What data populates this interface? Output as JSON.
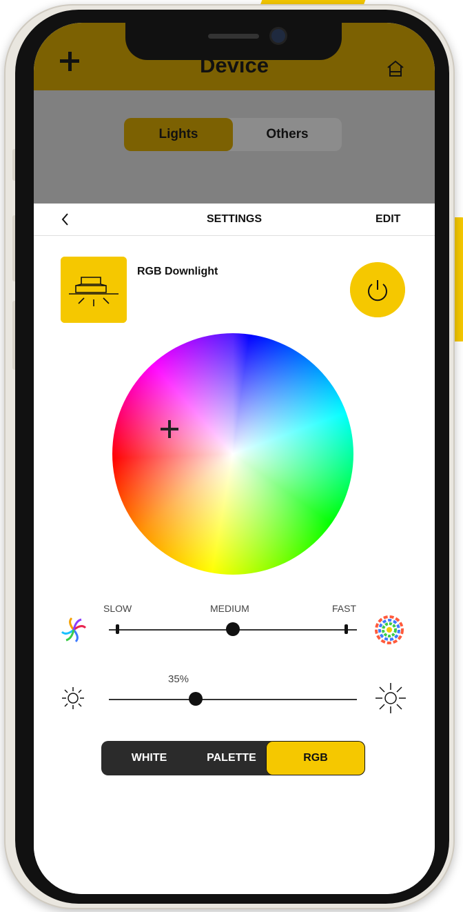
{
  "header": {
    "title": "Device"
  },
  "tabs": [
    {
      "label": "Lights",
      "active": true
    },
    {
      "label": "Others",
      "active": false
    }
  ],
  "settings": {
    "title": "SETTINGS",
    "edit_label": "EDIT",
    "device_name": "RGB Downlight"
  },
  "speed": {
    "labels": [
      "SLOW",
      "MEDIUM",
      "FAST"
    ],
    "value": "MEDIUM"
  },
  "brightness": {
    "value_label": "35%",
    "value": 0.35
  },
  "modes": [
    {
      "label": "WHITE",
      "active": false
    },
    {
      "label": "PALETTE",
      "active": false
    },
    {
      "label": "RGB",
      "active": true
    }
  ],
  "colors": {
    "accent": "#f5c800",
    "header_dimmed": "#7c6102",
    "overlay": "#808080"
  },
  "icons": [
    "plus-icon",
    "home-icon",
    "back-chevron-icon",
    "downlight-icon",
    "power-icon",
    "color-wheel",
    "pinwheel-slow-icon",
    "pinwheel-fast-icon",
    "sun-small-icon",
    "sun-large-icon"
  ]
}
